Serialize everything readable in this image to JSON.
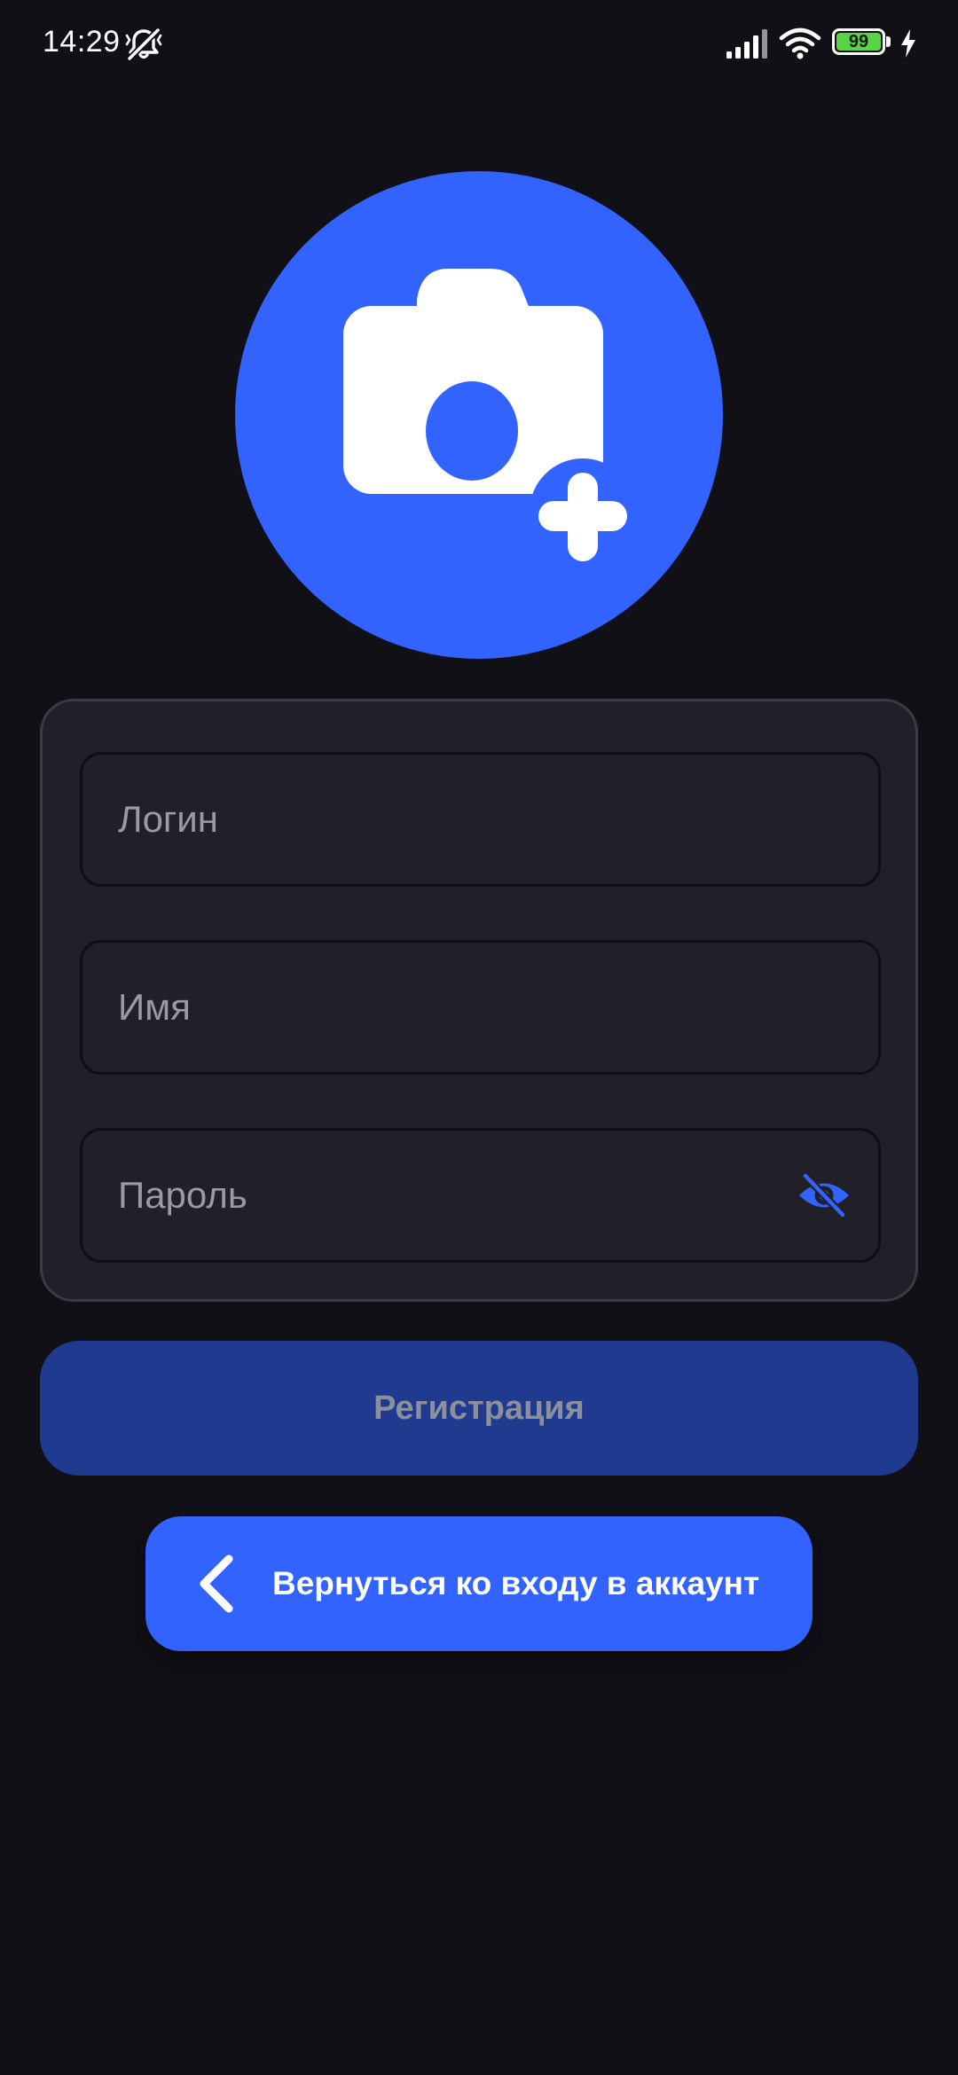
{
  "status_bar": {
    "time": "14:29",
    "battery_level": "99",
    "icons": [
      "mute-icon",
      "signal-icon",
      "wifi-icon",
      "battery-icon",
      "charging-icon"
    ]
  },
  "avatar": {
    "icon": "add-photo-camera-icon"
  },
  "form": {
    "login_placeholder": "Логин",
    "name_placeholder": "Имя",
    "password_placeholder": "Пароль",
    "password_toggle_icon": "eye-off-icon"
  },
  "register_button": {
    "label": "Регистрация"
  },
  "back_button": {
    "label": "Вернуться ко входу в аккаунт",
    "icon": "chevron-left-icon"
  },
  "colors": {
    "background": "#121017",
    "card": "#211f28",
    "accent": "#3263ff",
    "accent_disabled": "#203a8f",
    "placeholder": "#9b99a2",
    "battery": "#5bd246"
  }
}
